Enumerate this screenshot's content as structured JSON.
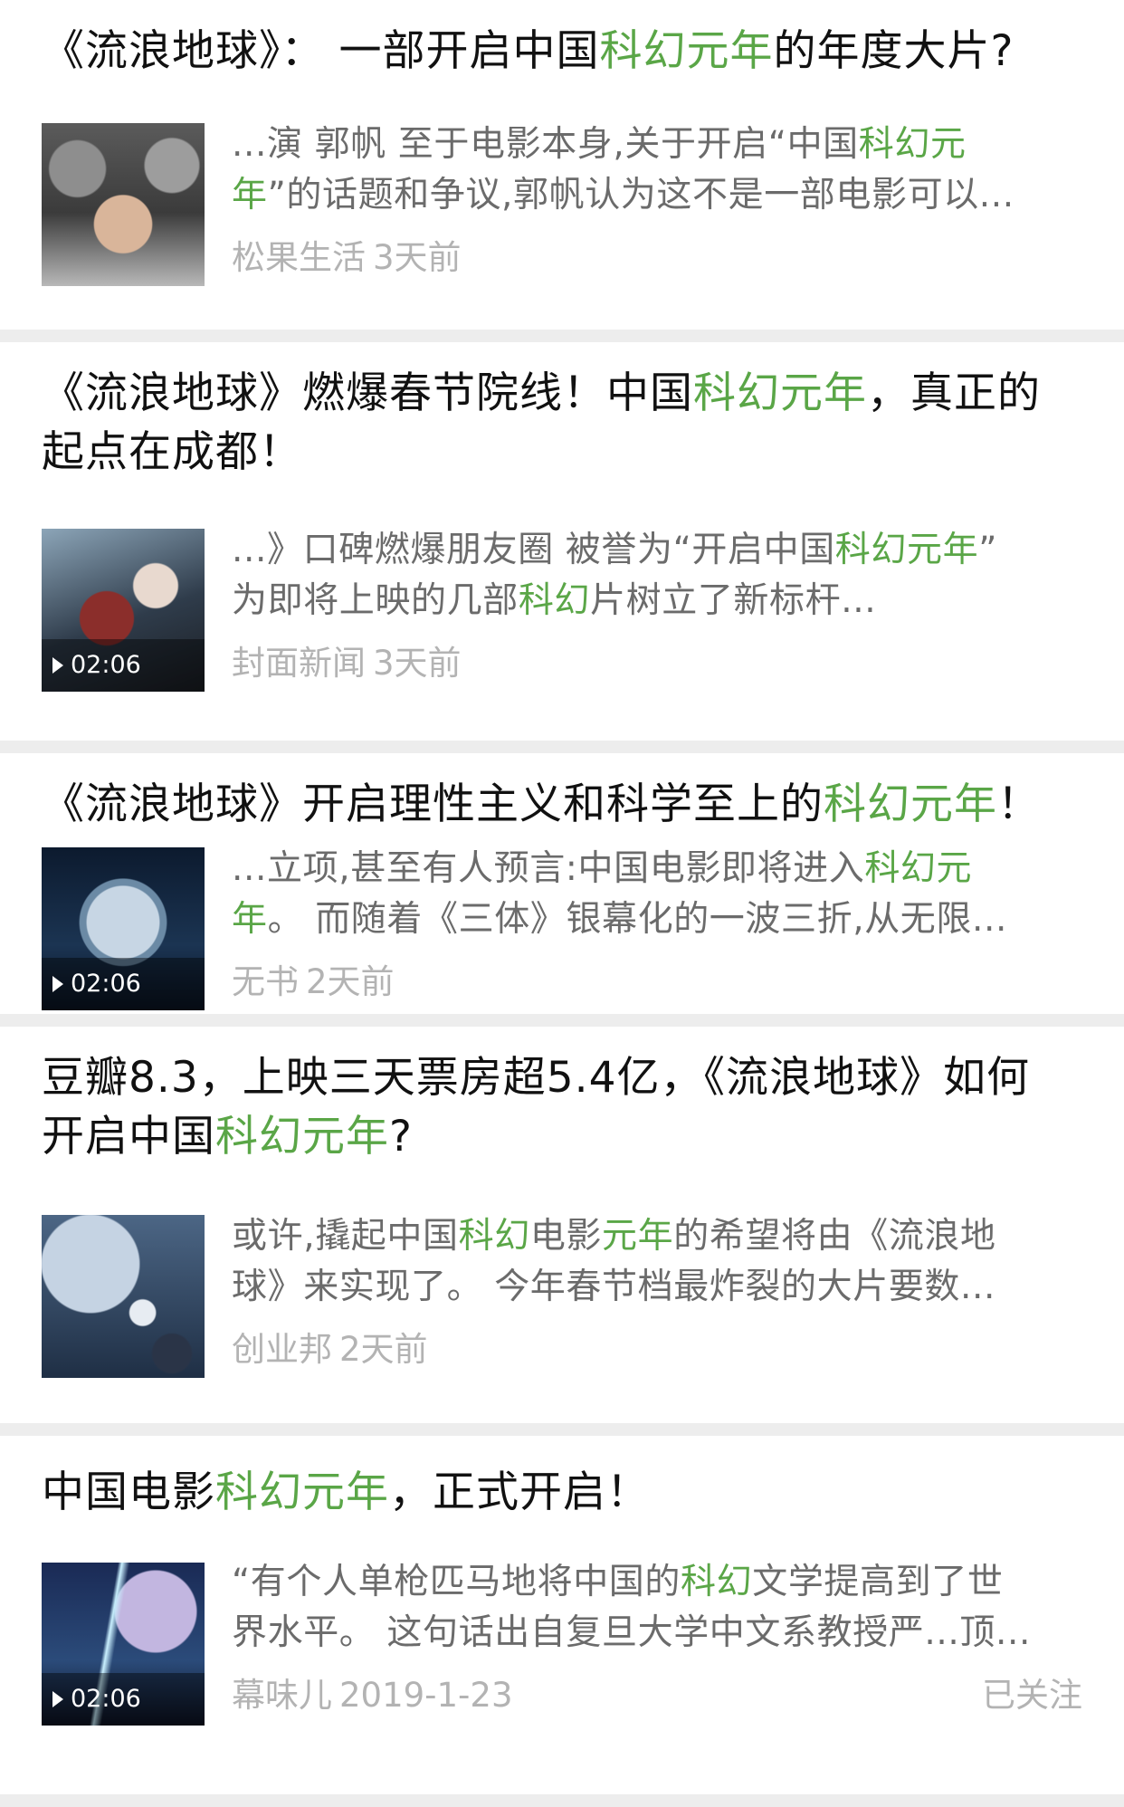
{
  "items": [
    {
      "title": [
        [
          "《流浪地球》： 一部开启中国",
          ""
        ],
        [
          "科幻元年",
          "hl"
        ],
        [
          "的年度大片?",
          ""
        ]
      ],
      "snippet_lines": [
        [
          [
            "...演 郭帆 至于电影本身,关于开启“中国",
            ""
          ],
          [
            "科幻元",
            "hl"
          ]
        ],
        [
          [
            "年",
            "hl"
          ],
          [
            "”的话题和争议,郭帆认为这不是一部电影可以...",
            ""
          ]
        ]
      ],
      "source": "松果生活",
      "time": "3天前",
      "thumb_icon": "movie-poster-thumbnail",
      "duration": ""
    },
    {
      "title_lines": [
        [
          [
            "《流浪地球》燃爆春节院线！中国",
            ""
          ],
          [
            "科幻元年",
            "hl"
          ],
          [
            "，真正的",
            ""
          ]
        ],
        [
          [
            "起点在成都！",
            ""
          ]
        ]
      ],
      "snippet_lines": [
        [
          [
            "...》口碑燃爆朋友圈 被誉为“开启中国",
            ""
          ],
          [
            "科幻元年",
            "hl"
          ],
          [
            "”",
            ""
          ]
        ],
        [
          [
            "为即将上映的几部",
            ""
          ],
          [
            "科幻",
            "hl"
          ],
          [
            "片树立了新标杆...",
            ""
          ]
        ]
      ],
      "source": "封面新闻",
      "time": "3天前",
      "thumb_icon": "astronaut-video-thumbnail",
      "duration": "02:06"
    },
    {
      "title": [
        [
          "《流浪地球》开启理性主义和科学至上的",
          ""
        ],
        [
          "科幻元年",
          "hl"
        ],
        [
          "！",
          ""
        ]
      ],
      "snippet_lines": [
        [
          [
            "...立项,甚至有人预言:中国电影即将进入",
            ""
          ],
          [
            "科幻元",
            "hl"
          ]
        ],
        [
          [
            "年",
            "hl"
          ],
          [
            "。 而随着《三体》银幕化的一波三折,从无限...",
            ""
          ]
        ]
      ],
      "source": "无书",
      "time": "2天前",
      "thumb_icon": "planet-video-thumbnail",
      "duration": "02:06"
    },
    {
      "title_lines": [
        [
          [
            "豆瓣8.3，上映三天票房超5.4亿，《流浪地球》如何",
            ""
          ]
        ],
        [
          [
            "开启中国",
            ""
          ],
          [
            "科幻元年",
            "hl"
          ],
          [
            "?",
            ""
          ]
        ]
      ],
      "snippet_lines": [
        [
          [
            "或许,撬起中国",
            ""
          ],
          [
            "科幻",
            "hl"
          ],
          [
            "电影",
            ""
          ],
          [
            "元年",
            "hl"
          ],
          [
            "的希望将由《流浪地",
            ""
          ]
        ],
        [
          [
            "球》来实现了。 今年春节档最炸裂的大片要数...",
            ""
          ]
        ]
      ],
      "source": "创业邦",
      "time": "2天前",
      "thumb_icon": "astronaut-planet-thumbnail",
      "duration": ""
    },
    {
      "title": [
        [
          "中国电影",
          ""
        ],
        [
          "科幻元年",
          "hl"
        ],
        [
          "，正式开启！",
          ""
        ]
      ],
      "snippet_lines": [
        [
          [
            "“有个人单枪匹马地将中国的",
            ""
          ],
          [
            "科幻",
            "hl"
          ],
          [
            "文学提高到了世",
            ""
          ]
        ],
        [
          [
            "界水平。 这句话出自复旦大学中文系教授严...顶...",
            ""
          ]
        ]
      ],
      "source": "幕味儿",
      "time": "2019-1-23",
      "thumb_icon": "galaxy-video-thumbnail",
      "duration": "02:06",
      "follow_label": "已关注"
    }
  ]
}
